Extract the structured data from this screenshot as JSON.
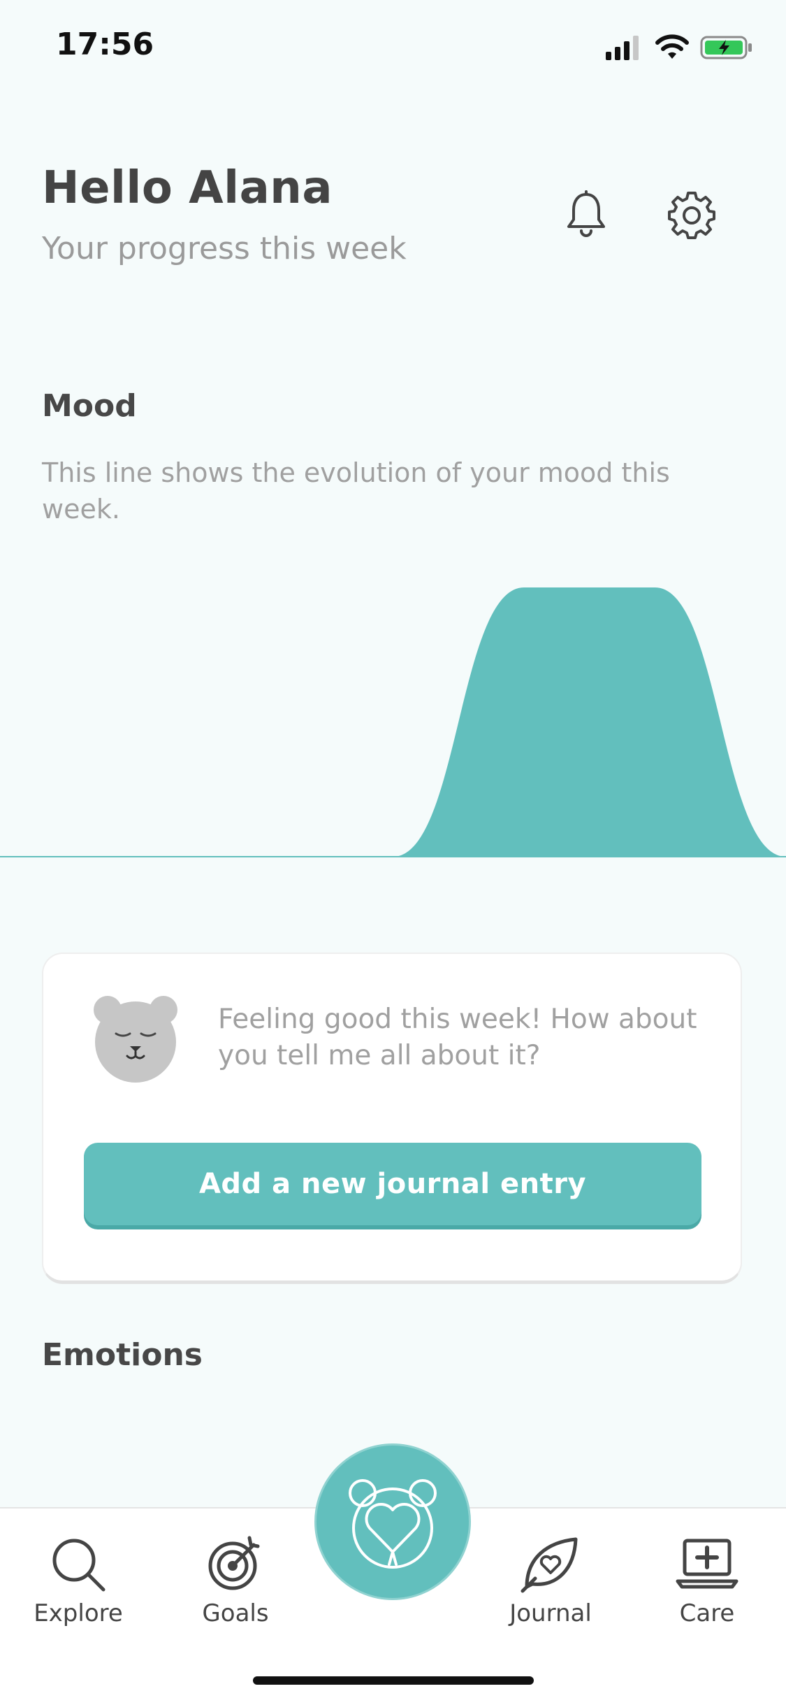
{
  "status_bar": {
    "time": "17:56",
    "icons": [
      "signal-icon",
      "wifi-icon",
      "battery-charging-icon"
    ]
  },
  "header": {
    "title": "Hello Alana",
    "subtitle": "Your progress this week",
    "icons": [
      "bell-icon",
      "gear-icon"
    ]
  },
  "mood": {
    "title": "Mood",
    "description": "This line shows the evolution of your mood this week."
  },
  "chart_data": {
    "type": "area",
    "title": "",
    "x": [
      0,
      1,
      2,
      3,
      4,
      5,
      6
    ],
    "values": [
      0,
      0,
      0,
      0,
      1,
      1,
      0
    ],
    "color": "#62bfbd"
  },
  "card": {
    "message": "Feeling good this week! How about you tell me all about it?",
    "button_label": "Add a new journal entry",
    "avatar_icon": "sleepy-bear-icon"
  },
  "emotions": {
    "title": "Emotions"
  },
  "tabbar": {
    "items": [
      {
        "label": "Explore",
        "icon": "search-icon"
      },
      {
        "label": "Goals",
        "icon": "target-icon"
      },
      {
        "label": "Journal",
        "icon": "leaf-heart-icon"
      },
      {
        "label": "Care",
        "icon": "laptop-plus-icon"
      }
    ],
    "center_icon": "bear-heart-icon"
  },
  "colors": {
    "accent": "#62bfbd",
    "background": "#f5fbfb",
    "text_primary": "#444444",
    "text_secondary": "#a0a0a0"
  }
}
